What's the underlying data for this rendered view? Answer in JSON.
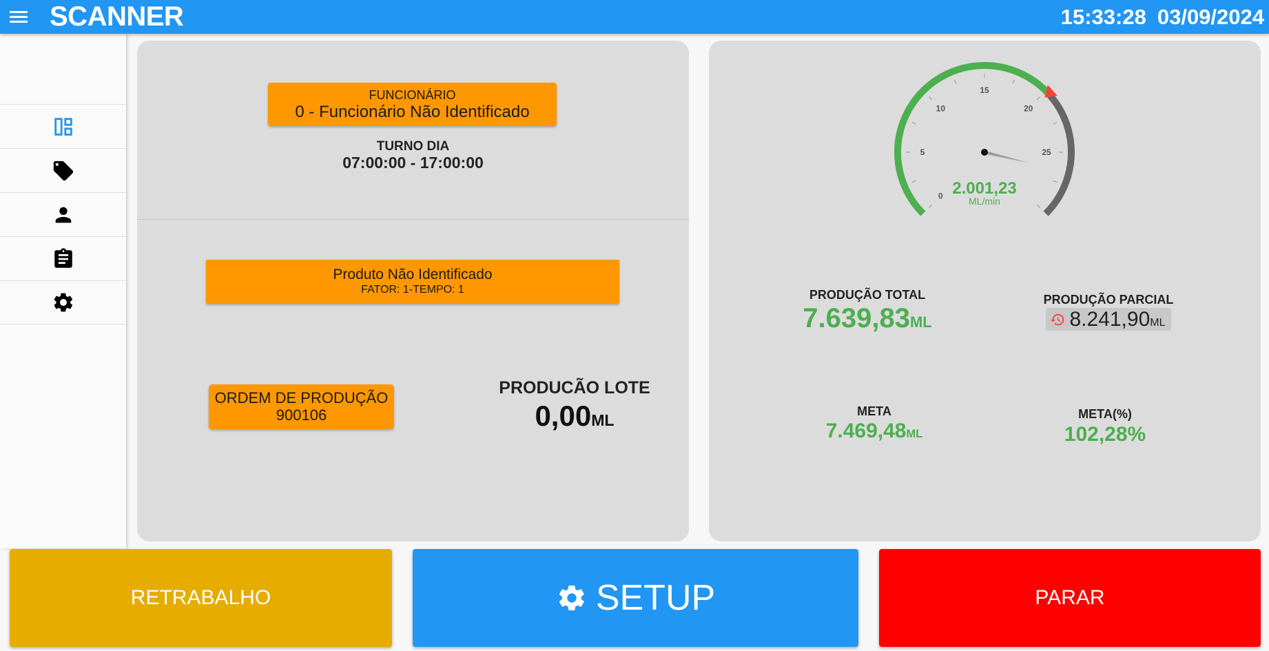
{
  "header": {
    "title": "SCANNER",
    "time": "15:33:28",
    "date": "03/09/2024",
    "menu_icon": "menu-icon"
  },
  "sidebar": {
    "items": [
      {
        "icon": "dashboard-icon",
        "active": true,
        "color": "#2196f3"
      },
      {
        "icon": "tag-icon"
      },
      {
        "icon": "person-icon"
      },
      {
        "icon": "clipboard-icon"
      },
      {
        "icon": "gear-icon"
      }
    ]
  },
  "employee": {
    "label": "FUNCIONÁRIO",
    "value": "0 - Funcionário Não Identificado"
  },
  "shift": {
    "label": "TURNO DIA",
    "value": "07:00:00 - 17:00:00"
  },
  "product": {
    "name": "Produto Não Identificado",
    "fator": "FATOR: 1-TEMPO: 1"
  },
  "order": {
    "label": "ORDEM DE PRODUÇÃO",
    "value": "900106"
  },
  "lot": {
    "label": "PRODUCÃO LOTE",
    "value": "0,00",
    "unit": "ML"
  },
  "gauge": {
    "value": "2.001,23",
    "unit": "ML/min",
    "ticks": [
      "0",
      "5",
      "10",
      "15",
      "20",
      "25"
    ],
    "min": 0,
    "max": 30,
    "needle": 26.5,
    "marker": 20.3,
    "colors": {
      "fill": "#4caf50",
      "rest": "#666666",
      "marker": "#f44336"
    }
  },
  "stats": {
    "total": {
      "label": "PRODUÇÃO TOTAL",
      "value": "7.639,83",
      "unit": "ML"
    },
    "parcial": {
      "label": "PRODUÇÃO PARCIAL",
      "value": "8.241,90",
      "unit": "ML",
      "icon": "reset-icon"
    },
    "meta": {
      "label": "META",
      "value": "7.469,48",
      "unit": "ML"
    },
    "meta_pct": {
      "label": "META(%)",
      "value": "102,28%"
    }
  },
  "actions": {
    "retrabalho": "RETRABALHO",
    "setup": "SETUP",
    "parar": "PARAR"
  },
  "colors": {
    "primary": "#2196f3",
    "orange": "#ff9800",
    "success": "#4caf50",
    "warning_btn": "#e6ad00",
    "danger": "#ff0000"
  }
}
